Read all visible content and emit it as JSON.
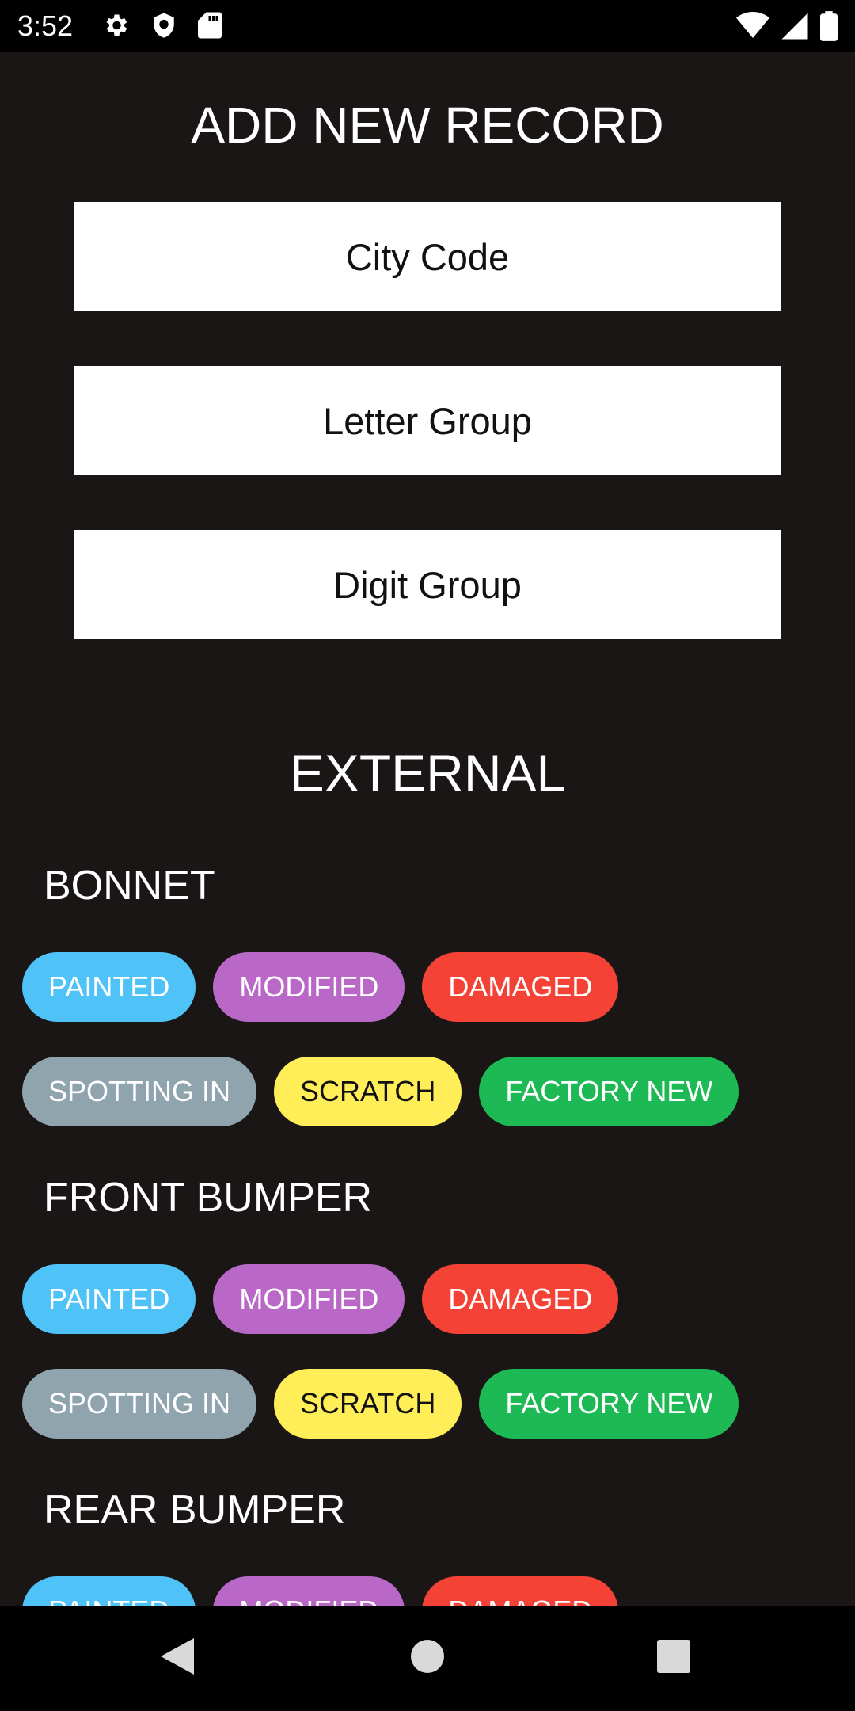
{
  "status_bar": {
    "time": "3:52",
    "left_icons": [
      "gear-icon",
      "shield-icon",
      "sd-card-icon"
    ],
    "right_icons": [
      "wifi-icon",
      "signal-icon",
      "battery-icon"
    ]
  },
  "form": {
    "title": "ADD NEW RECORD",
    "fields": [
      {
        "placeholder": "City Code",
        "value": ""
      },
      {
        "placeholder": "Letter Group",
        "value": ""
      },
      {
        "placeholder": "Digit Group",
        "value": ""
      }
    ]
  },
  "external": {
    "title": "EXTERNAL",
    "parts": [
      {
        "name": "BONNET",
        "rows": [
          [
            {
              "label": "PAINTED",
              "color": "#4fc3f7"
            },
            {
              "label": "MODIFIED",
              "color": "#ba68c8"
            },
            {
              "label": "DAMAGED",
              "color": "#f44336"
            }
          ],
          [
            {
              "label": "SPOTTING IN",
              "color": "#90a4ae"
            },
            {
              "label": "SCRATCH",
              "color": "#ffee58"
            },
            {
              "label": "FACTORY NEW",
              "color": "#1db954"
            }
          ]
        ]
      },
      {
        "name": "FRONT BUMPER",
        "rows": [
          [
            {
              "label": "PAINTED",
              "color": "#4fc3f7"
            },
            {
              "label": "MODIFIED",
              "color": "#ba68c8"
            },
            {
              "label": "DAMAGED",
              "color": "#f44336"
            }
          ],
          [
            {
              "label": "SPOTTING IN",
              "color": "#90a4ae"
            },
            {
              "label": "SCRATCH",
              "color": "#ffee58"
            },
            {
              "label": "FACTORY NEW",
              "color": "#1db954"
            }
          ]
        ]
      },
      {
        "name": "REAR BUMPER",
        "rows": [
          [
            {
              "label": "PAINTED",
              "color": "#4fc3f7"
            },
            {
              "label": "MODIFIED",
              "color": "#ba68c8"
            },
            {
              "label": "DAMAGED",
              "color": "#f44336"
            }
          ]
        ]
      }
    ]
  },
  "nav_bar": {
    "buttons": [
      "back-icon",
      "home-icon",
      "recents-icon"
    ]
  }
}
